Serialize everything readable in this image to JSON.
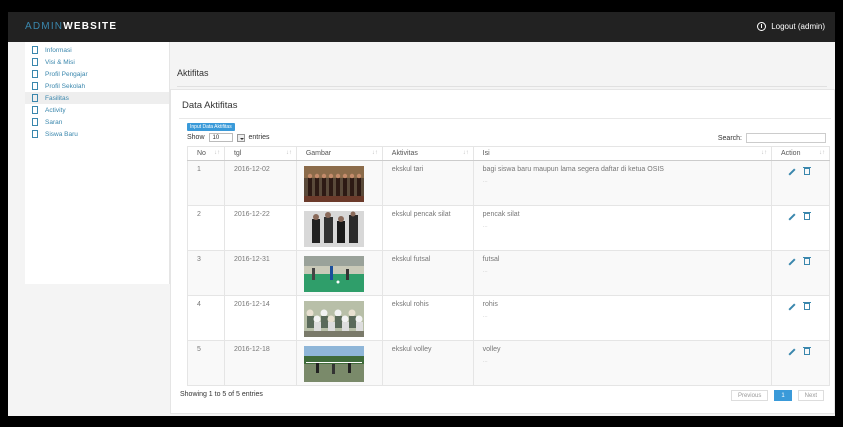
{
  "header": {
    "brand_prefix": "ADMIN",
    "brand_suffix": "WEBSITE",
    "logout_label": "Logout (admin)"
  },
  "sidebar": {
    "items": [
      {
        "label": "Informasi",
        "active": false
      },
      {
        "label": "Visi & Misi",
        "active": false
      },
      {
        "label": "Profil Pengajar",
        "active": false
      },
      {
        "label": "Profil Sekolah",
        "active": false
      },
      {
        "label": "Fasilitas",
        "active": true
      },
      {
        "label": "Activity",
        "active": false
      },
      {
        "label": "Saran",
        "active": false
      },
      {
        "label": "Siswa Baru",
        "active": false
      }
    ]
  },
  "page": {
    "title": "Aktifitas"
  },
  "panel": {
    "title": "Data Aktifitas",
    "add_button": "Input Data Aktifitas",
    "show_label": "Show",
    "entries_value": "10",
    "entries_label": "entries",
    "search_label": "Search:",
    "columns": [
      "No",
      "tgl",
      "Gambar",
      "Aktivitas",
      "Isi",
      "Action"
    ],
    "rows": [
      {
        "no": "1",
        "tgl": "2016-12-02",
        "aktivitas": "ekskul tari",
        "isi": "bagi siswa baru maupun lama segera daftar di ketua OSIS",
        "isi_more": "...",
        "image": "dance-group-photo"
      },
      {
        "no": "2",
        "tgl": "2016-12-22",
        "aktivitas": "ekskul pencak silat",
        "isi": "pencak silat",
        "isi_more": "...",
        "image": "martial-arts-photo"
      },
      {
        "no": "3",
        "tgl": "2016-12-31",
        "aktivitas": "ekskul futsal",
        "isi": "futsal",
        "isi_more": "...",
        "image": "futsal-photo"
      },
      {
        "no": "4",
        "tgl": "2016-12-14",
        "aktivitas": "ekskul rohis",
        "isi": "rohis",
        "isi_more": "...",
        "image": "rohis-group-photo"
      },
      {
        "no": "5",
        "tgl": "2016-12-18",
        "aktivitas": "ekskul volley",
        "isi": "volley",
        "isi_more": "...",
        "image": "volleyball-photo"
      }
    ],
    "info": "Showing 1 to 5 of 5 entries",
    "pagination": {
      "previous": "Previous",
      "current": "1",
      "next": "Next"
    }
  },
  "colors": {
    "topbar": "#222222",
    "accent": "#3a87ad",
    "button": "#3a9ad9"
  }
}
